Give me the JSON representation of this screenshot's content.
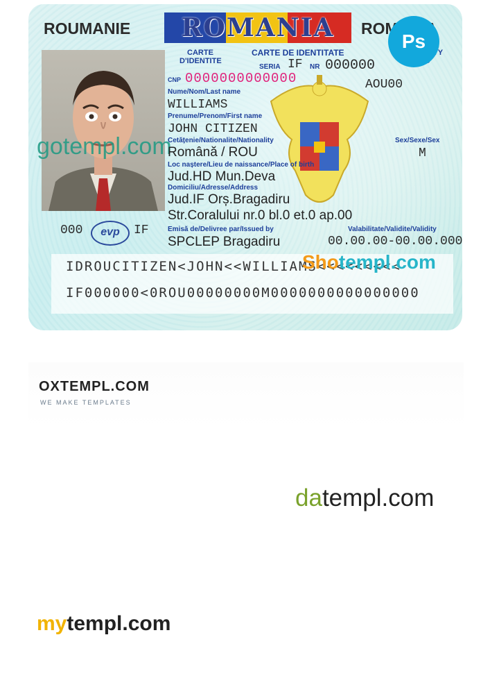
{
  "card": {
    "country_left": "ROUMANIE",
    "country_center": "ROMANIA",
    "country_right": "ROMANIA",
    "doc_title_fr": "CARTE D'IDENTITE",
    "doc_title_ro": "CARTE DE IDENTITATE",
    "doc_title_en": "IDENTITY CARD",
    "seria_label": "SERIA",
    "seria_value": "IF",
    "nr_label": "NR",
    "nr_value": "000000",
    "cnp_label": "CNP",
    "cnp_value": "0000000000000",
    "code": "AOU00",
    "last_name_label": "Nume/Nom/Last name",
    "last_name": "WILLIAMS",
    "first_name_label": "Prenume/Prenom/First name",
    "first_name": "JOHN CITIZEN",
    "nationality_label": "Cetățenie/Nationalite/Nationality",
    "nationality": "Română / ROU",
    "sex_label": "Sex/Sexe/Sex",
    "sex": "M",
    "birthplace_label": "Loc naștere/Lieu de naissance/Place of birth",
    "birthplace": "Jud.HD Mun.Deva",
    "address_label": "Domiciliu/Adresse/Address",
    "address_line1": "Jud.IF Orș.Bragadiru",
    "address_line2": "Str.Coralului nr.0 bl.0 et.0 ap.00",
    "issued_label": "Emisă de/Delivree par/Issued by",
    "issued_by": "SPCLEP Bragadiru",
    "validity_label": "Valabilitate/Validite/Validity",
    "validity": "00.00.00-00.00.0000",
    "stamp_left": "000",
    "stamp_logo": "evp",
    "stamp_right": "IF",
    "mrz_line1": "IDROUCITIZEN<JOHN<<WILLIAMS<<<<<<<<<",
    "mrz_line2": "IF000000<0ROU00000000M0000000000000000"
  },
  "badges": {
    "ps_label": "Ps"
  },
  "watermarks": {
    "gotempl": "gotempl.com",
    "shotempl_a": "Sho",
    "shotempl_b": "templ.com",
    "oxtempl": "OXTEMPL.COM",
    "oxtempl_sub": "WE MAKE TEMPLATES",
    "datempl_a": "da",
    "datempl_b": "templ.com",
    "mytempl_a": "my",
    "mytempl_b": "templ.com"
  }
}
